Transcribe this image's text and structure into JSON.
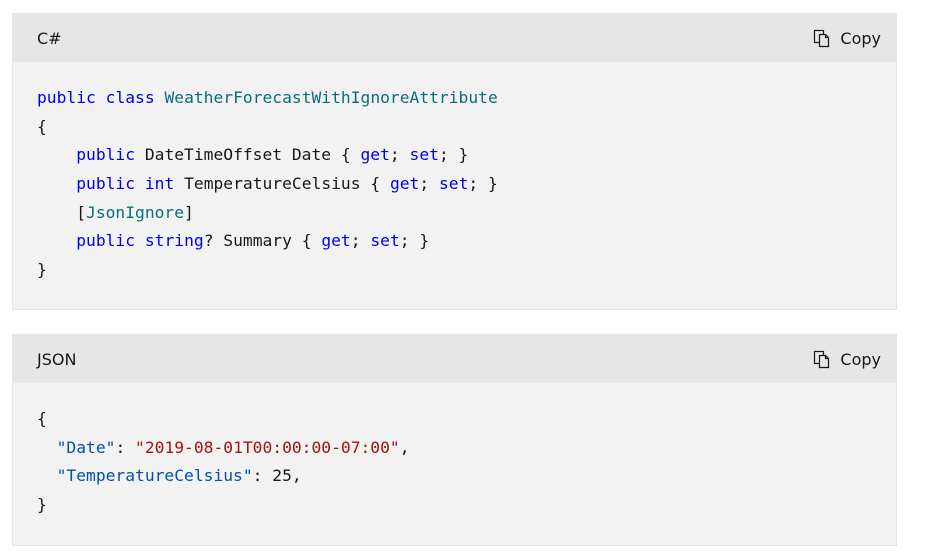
{
  "blocks": [
    {
      "language": "C#",
      "copy_label": "Copy",
      "lines": [
        [
          {
            "t": "public",
            "c": "kw"
          },
          {
            "t": " "
          },
          {
            "t": "class",
            "c": "kw"
          },
          {
            "t": " "
          },
          {
            "t": "WeatherForecastWithIgnoreAttribute",
            "c": "type"
          }
        ],
        [
          {
            "t": "{"
          }
        ],
        [
          {
            "t": "    "
          },
          {
            "t": "public",
            "c": "kw"
          },
          {
            "t": " DateTimeOffset Date { "
          },
          {
            "t": "get",
            "c": "kw"
          },
          {
            "t": "; "
          },
          {
            "t": "set",
            "c": "kw"
          },
          {
            "t": "; }"
          }
        ],
        [
          {
            "t": "    "
          },
          {
            "t": "public",
            "c": "kw"
          },
          {
            "t": " "
          },
          {
            "t": "int",
            "c": "kw"
          },
          {
            "t": " TemperatureCelsius { "
          },
          {
            "t": "get",
            "c": "kw"
          },
          {
            "t": "; "
          },
          {
            "t": "set",
            "c": "kw"
          },
          {
            "t": "; }"
          }
        ],
        [
          {
            "t": "    ["
          },
          {
            "t": "JsonIgnore",
            "c": "type"
          },
          {
            "t": "]"
          }
        ],
        [
          {
            "t": "    "
          },
          {
            "t": "public",
            "c": "kw"
          },
          {
            "t": " "
          },
          {
            "t": "string",
            "c": "kw"
          },
          {
            "t": "? Summary { "
          },
          {
            "t": "get",
            "c": "kw"
          },
          {
            "t": "; "
          },
          {
            "t": "set",
            "c": "kw"
          },
          {
            "t": "; }"
          }
        ],
        [
          {
            "t": "}"
          }
        ]
      ]
    },
    {
      "language": "JSON",
      "copy_label": "Copy",
      "lines": [
        [
          {
            "t": "{"
          }
        ],
        [
          {
            "t": "  "
          },
          {
            "t": "\"Date\"",
            "c": "prop"
          },
          {
            "t": ": "
          },
          {
            "t": "\"2019-08-01T00:00:00-07:00\"",
            "c": "str"
          },
          {
            "t": ","
          }
        ],
        [
          {
            "t": "  "
          },
          {
            "t": "\"TemperatureCelsius\"",
            "c": "prop"
          },
          {
            "t": ": 25,"
          }
        ],
        [
          {
            "t": "}"
          }
        ]
      ]
    }
  ],
  "icons": {
    "copy": "copy-icon"
  },
  "colors": {
    "keyword": "#0000e6",
    "type": "#0a6e78",
    "string": "#a31515",
    "property": "#0451a5",
    "header_bg": "#e6e6e6",
    "code_bg": "#f2f2f2"
  }
}
